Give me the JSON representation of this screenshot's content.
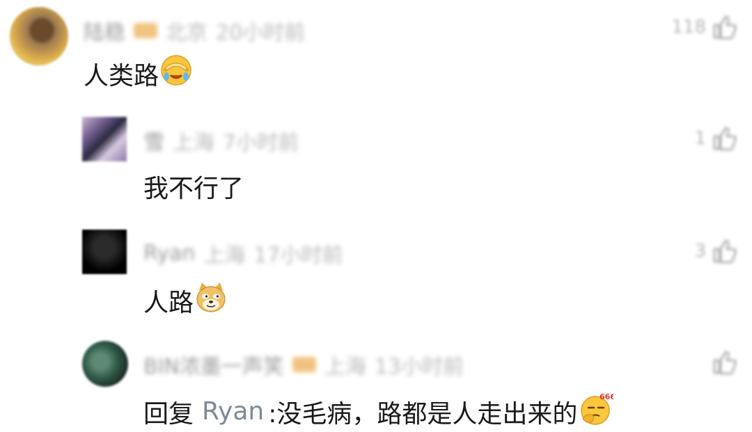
{
  "comments": [
    {
      "username": "陆稳",
      "location": "北京",
      "time": "20小时前",
      "likes": "118",
      "text": "人类路",
      "emoji": "facepalm-crying-emoji"
    },
    {
      "username": "雪",
      "location": "上海",
      "time": "7小时前",
      "likes": "1",
      "text": "我不行了"
    },
    {
      "username": "Ryan",
      "location": "上海",
      "time": "17小时前",
      "likes": "3",
      "text": "人路",
      "emoji": "doge-emoji"
    },
    {
      "username": "BIN浓墨一声笑",
      "location": "上海",
      "time": "13小时前",
      "likes": "",
      "reply_prefix": "回复",
      "reply_to": "Ryan",
      "text": ":没毛病，路都是人走出来的",
      "emoji": "666-thinking-emoji"
    }
  ]
}
